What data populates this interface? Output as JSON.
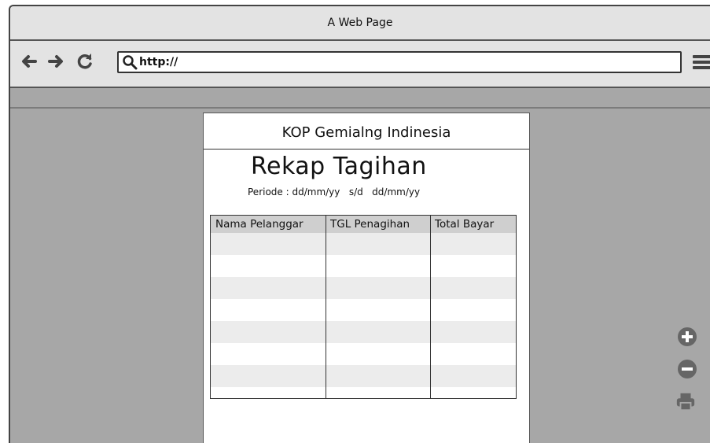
{
  "window": {
    "title": "A Web Page"
  },
  "navbar": {
    "back_icon": "arrow-left-icon",
    "forward_icon": "arrow-right-icon",
    "reload_icon": "reload-icon",
    "url": "http://",
    "menu_icon": "hamburger-menu-icon"
  },
  "report": {
    "kop": "KOP Gemialng Indinesia",
    "title": "Rekap Tagihan",
    "periode": "Periode : dd/mm/yy   s/d   dd/mm/yy",
    "table": {
      "columns": [
        "Nama Pelanggar",
        "TGL Penagihan",
        "Total Bayar"
      ],
      "rows": []
    }
  },
  "side_controls": [
    "zoom-in-icon",
    "zoom-out-icon",
    "print-icon"
  ],
  "colors": {
    "chrome": "#e3e3e3",
    "canvas": "#a7a7a7",
    "table_header": "#cfcfcf",
    "row_alt": "#ececec"
  }
}
